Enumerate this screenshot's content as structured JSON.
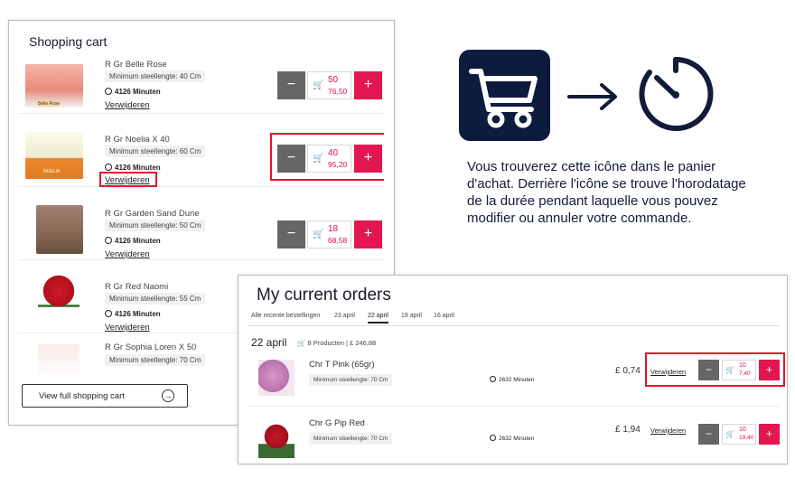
{
  "cart": {
    "title": "Shopping cart",
    "items": [
      {
        "name": "R Gr Belle Rose",
        "min_length": "Minimum steellengte: 40 Cm",
        "timer": "4126 Minuten",
        "remove": "Verwijderen",
        "qty": "50",
        "price": "76,50",
        "image_text": "Belle Rose"
      },
      {
        "name": "R Gr Noelia X 40",
        "min_length": "Minimum steellengte: 60 Cm",
        "timer": "4126 Minuten",
        "remove": "Verwijderen",
        "qty": "40",
        "price": "95,20",
        "image_text": "NOELIA"
      },
      {
        "name": "R Gr Garden Sand Dune",
        "min_length": "Minimum steellengte: 50 Cm",
        "timer": "4126 Minuten",
        "remove": "Verwijderen",
        "qty": "18",
        "price": "68,58"
      },
      {
        "name": "R Gr Red Naomi",
        "min_length": "Minimum steellengte: 55 Cm",
        "timer": "4126 Minuten",
        "remove": "Verwijderen",
        "qty": "",
        "price": ""
      },
      {
        "name": "R Gr Sophia Loren X 50",
        "min_length": "Minimum steellengte: 70 Cm",
        "timer": "",
        "remove": "",
        "qty": "",
        "price": ""
      }
    ],
    "view_full": "View full shopping cart"
  },
  "caption": "Vous trouverez cette icône dans le panier d'achat. Derrière l'icône se trouve l'horodatage de la durée pendant laquelle vous pouvez modifier ou annuler votre commande.",
  "orders": {
    "title": "My current orders",
    "tabs": [
      "Alle recente bestellingen",
      "23 april",
      "22 april",
      "19 april",
      "16 april"
    ],
    "active_tab": "22 april",
    "date": "22 april",
    "summary": "8 Producten | £ 246,88",
    "rows": [
      {
        "name": "Chr T Pink (65gr)",
        "min_length": "Minimum steellengte: 70 Cm",
        "timer": "2632 Minuten",
        "price": "£ 0,74",
        "remove": "Verwijderen",
        "qty": "10",
        "subtotal": "7,40"
      },
      {
        "name": "Chr G Pip Red",
        "min_length": "Minimum steellengte: 70 Cm",
        "timer": "2632 Minuten",
        "price": "£ 1,94",
        "remove": "Verwijderen",
        "qty": "10",
        "subtotal": "19,40"
      }
    ]
  },
  "colors": {
    "accent": "#e3174f",
    "highlight": "#e4142c",
    "navy": "#0d1b3d",
    "minus_button": "#666666"
  },
  "icons": {
    "cart": "cart-icon",
    "arrow": "arrow-right-icon",
    "stopwatch": "stopwatch-icon",
    "timer": "clock-icon"
  }
}
